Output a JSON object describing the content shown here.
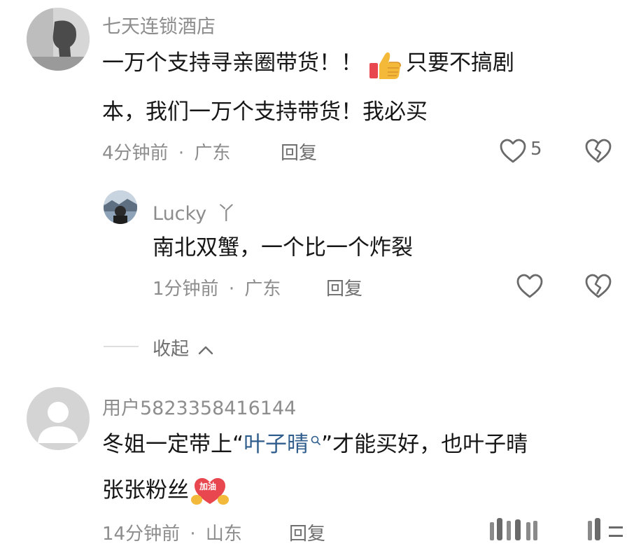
{
  "comments": [
    {
      "username": "七天连锁酒店",
      "text_line1_a": "一万个支持寻亲圈带货！！",
      "thumb_icon": "thumbs-up-icon",
      "text_line1_b": "只要不搞剧",
      "text_line2": "本，我们一万个支持带货！我必买",
      "time": "4分钟前",
      "location": "广东",
      "reply_label": "回复",
      "like_count": "5"
    },
    {
      "username": "Lucky",
      "username_suffix": "丫",
      "text": "南北双蟹，一个比一个炸裂",
      "time": "1分钟前",
      "location": "广东",
      "reply_label": "回复"
    },
    {
      "username": "用户5823358416144",
      "text_a": "冬姐一定带上“",
      "link_text": "叶子晴",
      "text_b": "”才能买好，也叶子晴",
      "text_line2": "张张粉丝",
      "emoji_label": "加油",
      "time": "14分钟前",
      "location": "山东",
      "reply_label": "回复"
    }
  ],
  "collapse_label": "收起",
  "separator": "·",
  "colors": {
    "text_primary": "#161616",
    "text_secondary": "#8d8d8d",
    "link": "#2f5d8c",
    "emoji_red": "#e8474f",
    "emoji_yellow": "#f2b93b"
  }
}
